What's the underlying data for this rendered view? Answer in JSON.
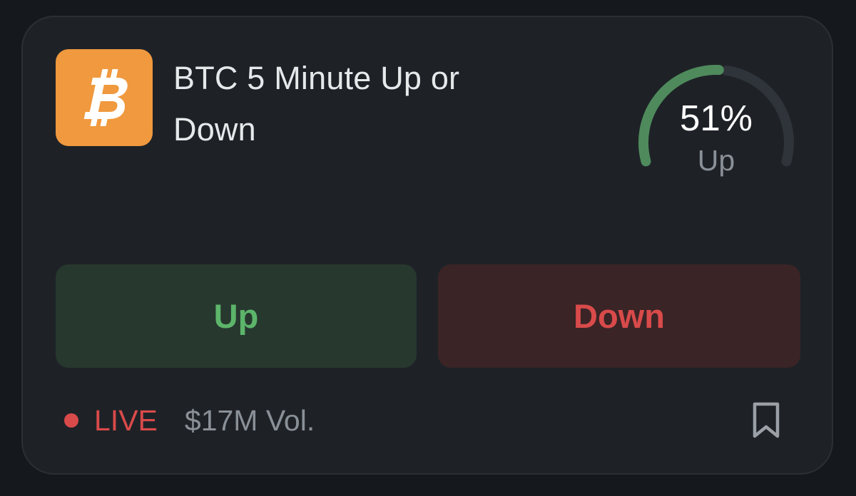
{
  "market": {
    "title": "BTC 5 Minute Up or Down",
    "icon": "bitcoin-icon",
    "icon_color": "#f0993e"
  },
  "gauge": {
    "percent_text": "51%",
    "label": "Up",
    "value": 0.51,
    "fill_color": "#4f8a5c",
    "track_color": "#2e343a"
  },
  "buttons": {
    "up_label": "Up",
    "down_label": "Down",
    "up_color": "#5cb56a",
    "down_color": "#d94a4a"
  },
  "footer": {
    "live_label": "LIVE",
    "volume": "$17M Vol.",
    "bookmark_icon": "bookmark-icon"
  }
}
